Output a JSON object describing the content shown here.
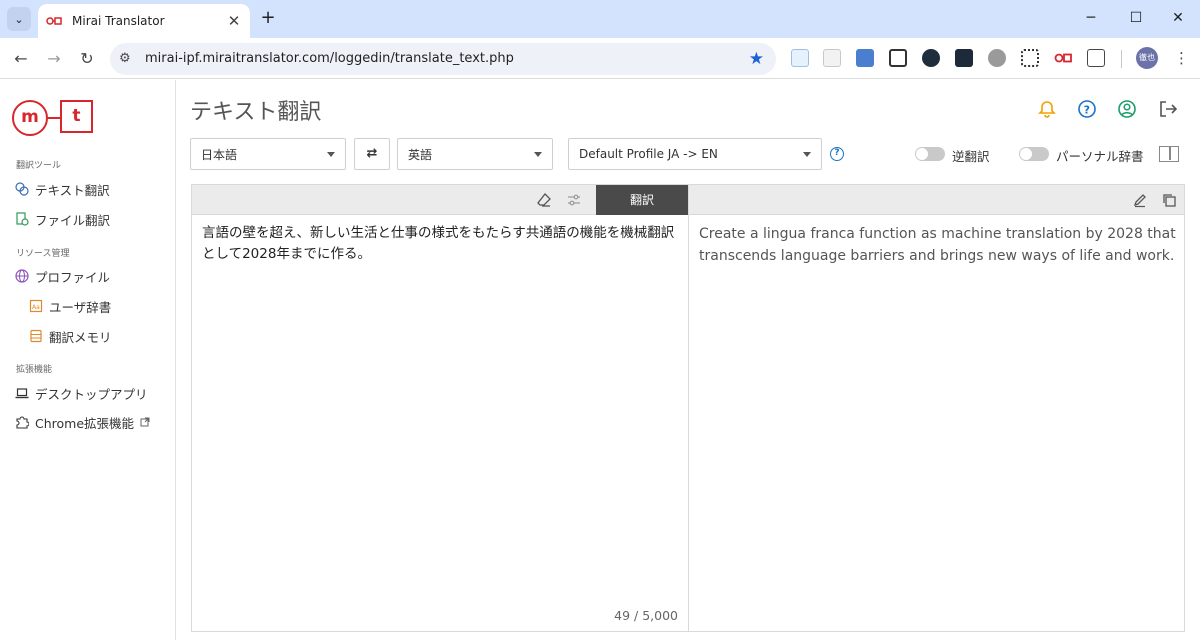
{
  "browser": {
    "tab_title": "Mirai Translator",
    "url": "mirai-ipf.miraitranslator.com/loggedin/translate_text.php",
    "profile_initials": "徹也",
    "colors": {
      "tabbar": "#d3e3fd",
      "star": "#1a62d6"
    }
  },
  "sidebar": {
    "logo_m": "m",
    "logo_t": "t",
    "section_tools": "翻訳ツール",
    "item_text_translate": "テキスト翻訳",
    "item_file_translate": "ファイル翻訳",
    "section_resources": "リソース管理",
    "item_profile": "プロファイル",
    "item_user_dict": "ユーザ辞書",
    "item_translation_memory": "翻訳メモリ",
    "section_extensions": "拡張機能",
    "item_desktop_app": "デスクトップアプリ",
    "item_chrome_ext": "Chrome拡張機能"
  },
  "main": {
    "title": "テキスト翻訳",
    "source_lang": "日本語",
    "target_lang": "英語",
    "swap_symbol": "⇄",
    "profile_select": "Default Profile JA -> EN",
    "reverse_translation_label": "逆翻訳",
    "personal_dict_label": "パーソナル辞書",
    "translate_button": "翻訳",
    "source_text": "言語の壁を超え、新しい生活と仕事の様式をもたらす共通語の機能を機械翻訳として2028年までに作る。",
    "target_text": "Create a lingua franca function as machine translation by 2028 that transcends language barriers and brings new ways of life and work.",
    "char_count": "49 / 5,000"
  },
  "colors": {
    "brand_red": "#d8262d",
    "bell": "#f0a202",
    "help": "#1a73c9",
    "user": "#1a9c6b"
  }
}
